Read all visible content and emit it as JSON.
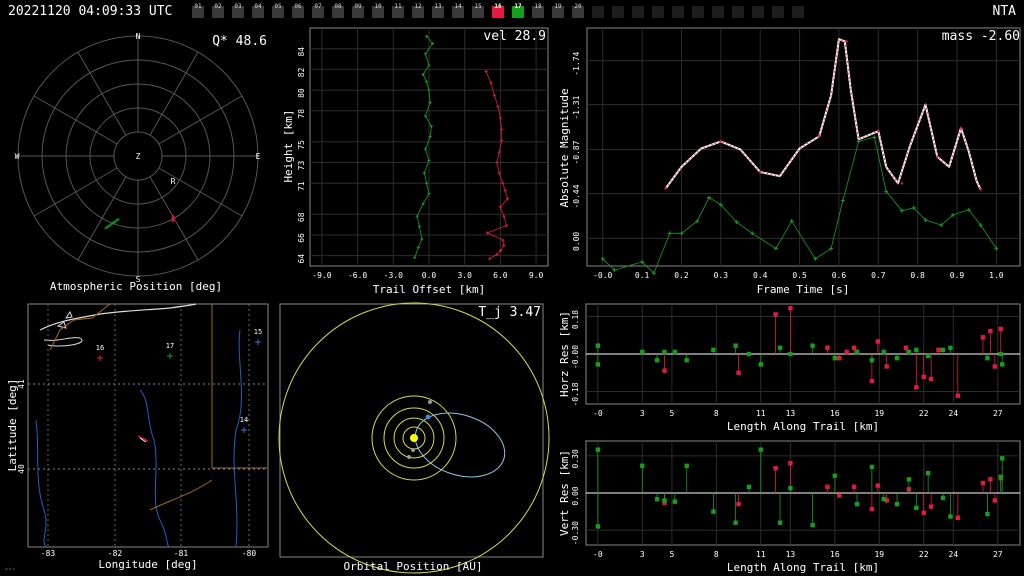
{
  "header": {
    "timestamp": "20221120 04:09:33 UTC",
    "station": "NTA",
    "frames": [
      {
        "label": "01",
        "state": "normal"
      },
      {
        "label": "02",
        "state": "normal"
      },
      {
        "label": "03",
        "state": "normal"
      },
      {
        "label": "04",
        "state": "normal"
      },
      {
        "label": "05",
        "state": "normal"
      },
      {
        "label": "06",
        "state": "normal"
      },
      {
        "label": "07",
        "state": "normal"
      },
      {
        "label": "08",
        "state": "normal"
      },
      {
        "label": "09",
        "state": "normal"
      },
      {
        "label": "10",
        "state": "normal"
      },
      {
        "label": "11",
        "state": "normal"
      },
      {
        "label": "12",
        "state": "normal"
      },
      {
        "label": "13",
        "state": "normal"
      },
      {
        "label": "14",
        "state": "normal"
      },
      {
        "label": "15",
        "state": "normal"
      },
      {
        "label": "16",
        "state": "red"
      },
      {
        "label": "17",
        "state": "green"
      },
      {
        "label": "18",
        "state": "normal"
      },
      {
        "label": "19",
        "state": "normal"
      },
      {
        "label": "20",
        "state": "normal"
      },
      {
        "label": "",
        "state": "dim"
      },
      {
        "label": "",
        "state": "dim"
      },
      {
        "label": "",
        "state": "dim"
      },
      {
        "label": "",
        "state": "dim"
      },
      {
        "label": "",
        "state": "dim"
      },
      {
        "label": "",
        "state": "dim"
      },
      {
        "label": "",
        "state": "dim"
      },
      {
        "label": "",
        "state": "dim"
      },
      {
        "label": "",
        "state": "dim"
      },
      {
        "label": "",
        "state": "dim"
      },
      {
        "label": "",
        "state": "dim"
      }
    ]
  },
  "colors": {
    "red": "#e41a3c",
    "green": "#14a01a",
    "grid": "#555555",
    "axis": "#ffffff",
    "yellow": "#d8d84a",
    "blue": "#3a8fd8"
  },
  "atmos": {
    "title": "Atmospheric Position [deg]",
    "q_label": "Q* 48.6",
    "dirs": [
      "N",
      "E",
      "S",
      "W",
      "Z",
      "R"
    ]
  },
  "height_plot": {
    "title": "Trail Offset [km]",
    "ylabel": "Height [km]",
    "vel_label": "vel 28.9",
    "xticks": [
      "-9.0",
      "-6.0",
      "-3.0",
      "0.0",
      "3.0",
      "6.0",
      "9.0"
    ],
    "yticks": [
      "64",
      "66",
      "68",
      "71",
      "73",
      "75",
      "78",
      "80",
      "82",
      "84"
    ]
  },
  "mag_plot": {
    "xlabel": "Frame Time [s]",
    "ylabel": "Absolute Magnitude",
    "mass_label": "mass -2.60",
    "xticks": [
      "-0.0",
      "0.1",
      "0.2",
      "0.3",
      "0.4",
      "0.5",
      "0.6",
      "0.7",
      "0.8",
      "0.9",
      "1.0"
    ],
    "yticks": [
      "-1.74",
      "-1.31",
      "-0.87",
      "-0.44",
      "0.00"
    ]
  },
  "map": {
    "xlabel": "Longitude [deg]",
    "ylabel": "Latitude [deg]",
    "xticks": [
      "-83",
      "-82",
      "-81",
      "-80"
    ],
    "yticks": [
      "41",
      "40"
    ],
    "stations": [
      "16",
      "17",
      "15",
      "14"
    ],
    "corner": "ᵃᵇᶜ"
  },
  "orbit": {
    "title": "Orbital Position [AU]",
    "tj_label": "T_j 3.47"
  },
  "horz_res": {
    "xlabel": "Length Along Trail [km]",
    "ylabel": "Horz Res [km]",
    "xticks": [
      "-0",
      "3",
      "5",
      "8",
      "11",
      "13",
      "16",
      "19",
      "22",
      "24",
      "27"
    ],
    "yticks": [
      "0.18",
      "-0.00",
      "-0.18"
    ]
  },
  "vert_res": {
    "xlabel": "Length Along Trail [km]",
    "ylabel": "Vert Res [km]",
    "xticks": [
      "-0",
      "3",
      "5",
      "8",
      "11",
      "13",
      "16",
      "19",
      "22",
      "24",
      "27"
    ],
    "yticks": [
      "0.30",
      "0.00",
      "-0.30"
    ]
  },
  "chart_data": [
    {
      "type": "line",
      "title": "",
      "xlabel": "Trail Offset [km]",
      "ylabel": "Height [km]",
      "xlim": [
        -10,
        10
      ],
      "ylim": [
        63,
        86
      ],
      "series": [
        {
          "color": "green",
          "x": [
            -0.2,
            0.3,
            -0.3,
            0.0,
            -0.5,
            -0.2,
            0.0,
            0.1,
            -0.3,
            0.2,
            0.1,
            -0.3,
            0.0,
            -0.4,
            -0.2,
            0.0,
            -0.5,
            -1.0,
            -0.8,
            -0.6,
            -0.9,
            -1.2
          ],
          "y": [
            85.2,
            84.5,
            83.5,
            82.4,
            81.5,
            80.8,
            80.0,
            78.8,
            77.5,
            76.5,
            75.5,
            74.3,
            73.2,
            72.0,
            71.0,
            70.0,
            69.0,
            67.8,
            66.8,
            65.6,
            64.8,
            63.8
          ]
        },
        {
          "color": "red",
          "x": [
            4.8,
            5.2,
            5.5,
            5.8,
            6.0,
            6.1,
            6.1,
            5.9,
            5.7,
            5.9,
            6.2,
            6.4,
            6.6,
            6.0,
            6.3,
            6.5,
            4.9,
            6.2,
            6.3,
            6.0,
            5.7,
            5.1
          ],
          "y": [
            81.8,
            80.7,
            79.5,
            78.4,
            77.3,
            76.2,
            75.1,
            74.0,
            73.0,
            72.0,
            71.0,
            70.3,
            69.5,
            68.7,
            67.8,
            66.9,
            66.2,
            65.5,
            65.0,
            64.5,
            64.1,
            63.7
          ]
        }
      ]
    },
    {
      "type": "line",
      "title": "",
      "xlabel": "Frame Time [s]",
      "ylabel": "Absolute Magnitude",
      "xlim": [
        -0.04,
        1.06
      ],
      "ylim": [
        0.27,
        -2.06
      ],
      "series": [
        {
          "color": "white",
          "x": [
            0.16,
            0.2,
            0.25,
            0.3,
            0.35,
            0.4,
            0.45,
            0.5,
            0.55,
            0.58,
            0.6,
            0.615,
            0.63,
            0.65,
            0.7,
            0.72,
            0.75,
            0.78,
            0.82,
            0.85,
            0.88,
            0.91,
            0.93,
            0.95,
            0.96
          ],
          "y": [
            -0.49,
            -0.7,
            -0.88,
            -0.95,
            -0.87,
            -0.65,
            -0.61,
            -0.88,
            -1.0,
            -1.4,
            -1.95,
            -1.93,
            -1.46,
            -0.97,
            -1.05,
            -0.7,
            -0.54,
            -0.9,
            -1.31,
            -0.8,
            -0.7,
            -1.08,
            -0.85,
            -0.56,
            -0.48
          ]
        },
        {
          "color": "red",
          "x": [
            0.16,
            0.3,
            0.4,
            0.55,
            0.62,
            0.7,
            0.76,
            0.85,
            0.91,
            0.96
          ],
          "y": [
            -0.49,
            -0.95,
            -0.65,
            -1.0,
            -1.93,
            -1.05,
            -0.54,
            -0.8,
            -1.08,
            -0.48
          ]
        },
        {
          "color": "green",
          "x": [
            -0.0,
            0.03,
            0.1,
            0.13,
            0.17,
            0.2,
            0.24,
            0.27,
            0.3,
            0.34,
            0.38,
            0.44,
            0.48,
            0.54,
            0.58,
            0.61,
            0.65,
            0.69,
            0.72,
            0.76,
            0.79,
            0.82,
            0.86,
            0.89,
            0.93,
            0.96,
            1.0
          ],
          "y": [
            0.2,
            0.31,
            0.23,
            0.34,
            -0.05,
            -0.05,
            -0.17,
            -0.4,
            -0.33,
            -0.16,
            -0.05,
            0.1,
            -0.17,
            0.2,
            0.1,
            -0.37,
            -0.95,
            -0.99,
            -0.46,
            -0.27,
            -0.3,
            -0.18,
            -0.13,
            -0.23,
            -0.28,
            -0.13,
            0.1
          ]
        }
      ]
    },
    {
      "type": "scatter",
      "title": "",
      "xlabel": "Length Along Trail [km]",
      "ylabel": "Horz Res [km]",
      "xlim": [
        -0.8,
        28.5
      ],
      "ylim": [
        -0.24,
        0.24
      ],
      "series": [
        {
          "color": "red",
          "x": [
            4.5,
            9.5,
            12.0,
            13.0,
            15.5,
            16.3,
            16.8,
            17.3,
            18.5,
            18.9,
            19.5,
            20.8,
            21.5,
            22.0,
            22.5,
            23.0,
            24.3,
            26.0,
            26.5,
            26.8,
            27.2
          ],
          "y": [
            -0.08,
            -0.09,
            0.19,
            0.22,
            0.03,
            -0.02,
            0.01,
            0.03,
            -0.13,
            0.06,
            -0.06,
            0.03,
            -0.16,
            -0.11,
            -0.12,
            0.02,
            -0.2,
            0.08,
            0.11,
            -0.06,
            0.12
          ]
        },
        {
          "color": "green",
          "x": [
            0.0,
            0.0,
            3.0,
            4.0,
            4.5,
            5.2,
            6.0,
            7.8,
            9.3,
            10.2,
            11.0,
            12.3,
            13.0,
            14.5,
            16.0,
            17.5,
            18.5,
            19.3,
            20.2,
            21.0,
            21.5,
            22.3,
            23.3,
            23.8,
            26.3,
            27.2,
            27.3
          ],
          "y": [
            0.04,
            -0.05,
            0.01,
            -0.03,
            0.01,
            0.01,
            -0.03,
            0.02,
            0.04,
            0.0,
            -0.05,
            0.03,
            0.0,
            0.04,
            -0.02,
            0.01,
            -0.03,
            0.01,
            -0.02,
            0.01,
            0.02,
            -0.01,
            0.02,
            0.03,
            -0.02,
            0.0,
            -0.05
          ]
        }
      ]
    },
    {
      "type": "scatter",
      "title": "",
      "xlabel": "Length Along Trail [km]",
      "ylabel": "Vert Res [km]",
      "xlim": [
        -0.8,
        28.5
      ],
      "ylim": [
        -0.42,
        0.42
      ],
      "series": [
        {
          "color": "red",
          "x": [
            4.5,
            9.5,
            12.0,
            13.0,
            15.5,
            16.3,
            17.3,
            18.5,
            18.9,
            19.5,
            21.0,
            22.0,
            22.5,
            24.3,
            26.0,
            26.5,
            26.8,
            27.2
          ],
          "y": [
            -0.08,
            -0.09,
            0.2,
            0.24,
            0.05,
            -0.02,
            0.05,
            -0.13,
            0.06,
            -0.06,
            0.03,
            -0.16,
            -0.11,
            -0.2,
            0.08,
            0.11,
            -0.06,
            0.12
          ]
        },
        {
          "color": "green",
          "x": [
            0.0,
            0.0,
            3.0,
            4.0,
            4.5,
            5.2,
            6.0,
            7.8,
            9.3,
            10.2,
            11.0,
            12.3,
            13.0,
            14.5,
            16.0,
            17.5,
            18.5,
            19.3,
            20.2,
            21.0,
            21.5,
            22.3,
            23.3,
            23.8,
            26.3,
            27.2,
            27.3
          ],
          "y": [
            0.35,
            -0.27,
            0.22,
            -0.05,
            -0.06,
            -0.07,
            0.22,
            -0.15,
            -0.24,
            0.05,
            0.35,
            -0.24,
            0.04,
            -0.26,
            0.14,
            -0.09,
            0.21,
            -0.05,
            -0.09,
            0.11,
            -0.12,
            0.16,
            -0.04,
            -0.19,
            -0.17,
            0.13,
            0.28
          ]
        }
      ]
    }
  ]
}
